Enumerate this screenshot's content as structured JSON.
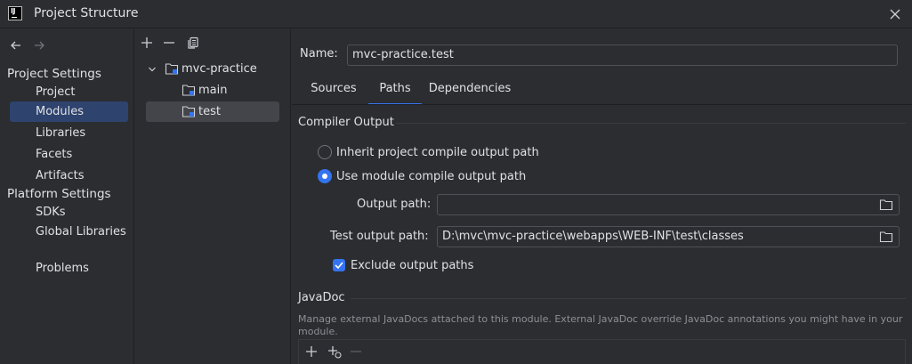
{
  "window": {
    "title": "Project Structure",
    "logo_text": "IJ"
  },
  "sidebar": {
    "project_settings_title": "Project Settings",
    "project_settings": [
      {
        "label": "Project"
      },
      {
        "label": "Modules"
      },
      {
        "label": "Libraries"
      },
      {
        "label": "Facets"
      },
      {
        "label": "Artifacts"
      }
    ],
    "platform_settings_title": "Platform Settings",
    "platform_settings": [
      {
        "label": "SDKs"
      },
      {
        "label": "Global Libraries"
      }
    ],
    "problems_label": "Problems",
    "selected": "Modules"
  },
  "tree": {
    "root": "mvc-practice",
    "children": [
      {
        "label": "main"
      },
      {
        "label": "test"
      }
    ],
    "selected": "test"
  },
  "module": {
    "name_label": "Name:",
    "name_value": "mvc-practice.test",
    "tabs": [
      {
        "label": "Sources"
      },
      {
        "label": "Paths"
      },
      {
        "label": "Dependencies"
      }
    ],
    "active_tab": "Paths"
  },
  "compiler_output": {
    "title": "Compiler Output",
    "inherit_label": "Inherit project compile output path",
    "use_module_label": "Use module compile output path",
    "output_path_label": "Output path:",
    "output_path_value": "",
    "test_output_path_label": "Test output path:",
    "test_output_path_value": "D:\\mvc\\mvc-practice\\webapps\\WEB-INF\\test\\classes",
    "exclude_label": "Exclude output paths",
    "exclude_checked": true
  },
  "javadoc": {
    "title": "JavaDoc",
    "hint": "Manage external JavaDocs attached to this module. External JavaDoc override JavaDoc annotations you might have in your module."
  },
  "colors": {
    "accent": "#3574f0",
    "selection": "#2e436e",
    "background": "#2b2d30"
  }
}
